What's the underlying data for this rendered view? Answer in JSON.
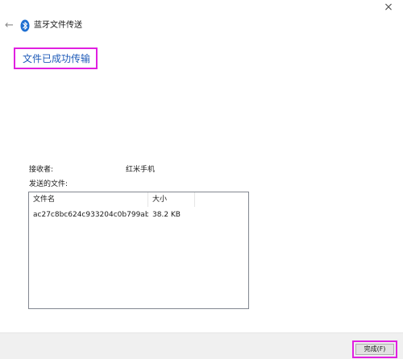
{
  "window": {
    "title": "蓝牙文件传送",
    "close_glyph": "×"
  },
  "heading": "文件已成功传输",
  "recipient": {
    "label": "接收者:",
    "value": "红米手机"
  },
  "files": {
    "label": "发送的文件:",
    "columns": [
      "文件名",
      "大小"
    ],
    "rows": [
      {
        "name": "ac27c8bc624c933204c0b799ab...",
        "size": "38.2 KB"
      }
    ]
  },
  "footer": {
    "finish_label": "完成(F)"
  },
  "icons": {
    "back": "back-arrow-icon",
    "bluetooth": "bluetooth-icon",
    "close": "close-icon"
  },
  "colors": {
    "heading": "#1f5bb8",
    "highlight": "#e020e0",
    "bluetooth": "#1f6fd1"
  }
}
